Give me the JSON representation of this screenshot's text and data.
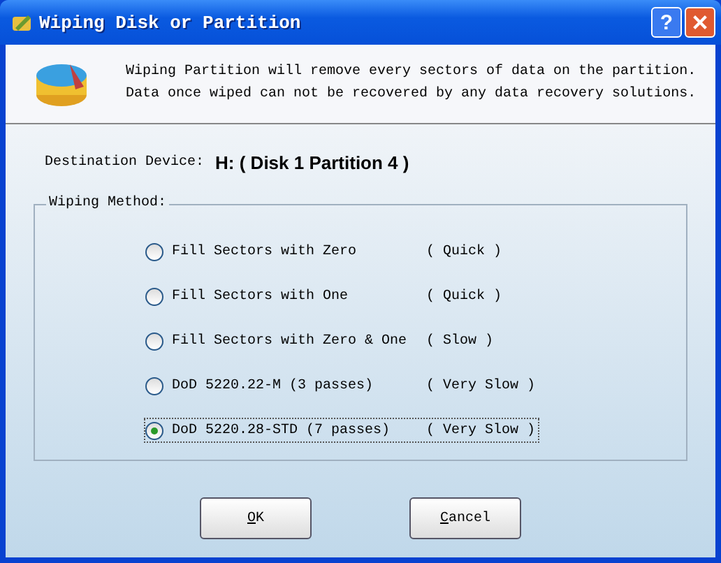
{
  "window": {
    "title": "Wiping Disk or Partition",
    "help": "?"
  },
  "header": {
    "lines": [
      "Wiping Partition will remove every sectors of data on the partition.",
      "Data once wiped can not be recovered by any data recovery solutions."
    ]
  },
  "destination": {
    "label": "Destination Device:",
    "value": "H: ( Disk 1 Partition 4 )"
  },
  "method": {
    "title": "Wiping Method:",
    "options": [
      {
        "label": "Fill Sectors with Zero",
        "speed": "( Quick )",
        "selected": false
      },
      {
        "label": "Fill Sectors with One",
        "speed": "( Quick )",
        "selected": false
      },
      {
        "label": "Fill Sectors with Zero & One",
        "speed": "( Slow )",
        "selected": false
      },
      {
        "label": "DoD 5220.22-M (3 passes)",
        "speed": "( Very Slow )",
        "selected": false
      },
      {
        "label": "DoD 5220.28-STD (7 passes)",
        "speed": "( Very Slow )",
        "selected": true
      }
    ]
  },
  "buttons": [
    "OK",
    "Cancel"
  ]
}
